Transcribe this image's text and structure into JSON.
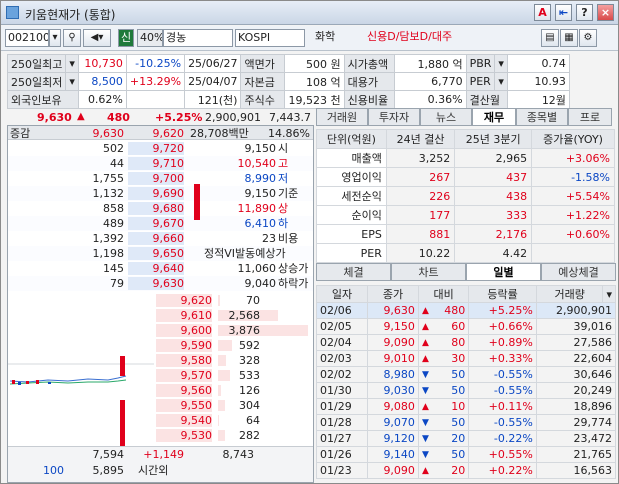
{
  "window": {
    "title": "키움현재가 (통합)",
    "buttons": [
      "A",
      "⇤",
      "?",
      "×"
    ]
  },
  "toolbar": {
    "code": "002100",
    "badge_sin": "신",
    "ratio": "40%",
    "name": "경농",
    "market": "KOSPI",
    "sector": "화학",
    "credit": "신용D/담보D/대주"
  },
  "info": {
    "rows": [
      [
        "250일최고",
        "10,730",
        "-10.25%",
        "25/06/27",
        "액면가",
        "500 원",
        "시가총액",
        "1,880 억",
        "PBR",
        "0.74"
      ],
      [
        "250일최저",
        "8,500",
        "+13.29%",
        "25/04/07",
        "자본금",
        "108 억",
        "대용가",
        "6,770",
        "PER",
        "10.93"
      ],
      [
        "외국인보유",
        "0.62%",
        "",
        "121(천)",
        "주식수",
        "19,523 천",
        "신용비율",
        "0.36%",
        "결산월",
        "12월"
      ]
    ]
  },
  "price": {
    "current": "9,630",
    "change": "480",
    "rate": "+5.25%",
    "volume": "2,900,901",
    "extra": "7,443.7"
  },
  "hoga": {
    "header": [
      "증감",
      "9,630",
      "9,620",
      "28,708백만",
      "14.86%"
    ],
    "ask": [
      {
        "qty": "502",
        "price": "9,720",
        "label_v": "9,150",
        "label_k": "시"
      },
      {
        "qty": "44",
        "price": "9,710",
        "label_v": "10,540",
        "label_k": "고"
      },
      {
        "qty": "1,755",
        "price": "9,700",
        "label_v": "8,990",
        "label_k": "저"
      },
      {
        "qty": "1,132",
        "price": "9,690",
        "label_v": "9,150",
        "label_k": "기준"
      },
      {
        "qty": "858",
        "price": "9,680",
        "label_v": "11,890",
        "label_k": "상"
      },
      {
        "qty": "489",
        "price": "9,670",
        "label_v": "6,410",
        "label_k": "하"
      },
      {
        "qty": "1,392",
        "price": "9,660",
        "label_v": "23",
        "label_k": "비용"
      },
      {
        "qty": "1,198",
        "price": "9,650",
        "label_v": "정적VI발동예상가",
        "label_k": ""
      },
      {
        "qty": "145",
        "price": "9,640",
        "label_v": "11,060",
        "label_k": "상승가"
      },
      {
        "qty": "79",
        "price": "9,630",
        "label_v": "9,040",
        "label_k": "하락가"
      }
    ],
    "bid": [
      {
        "price": "9,620",
        "qty": "70"
      },
      {
        "price": "9,610",
        "qty": "2,568"
      },
      {
        "price": "9,600",
        "qty": "3,876"
      },
      {
        "price": "9,590",
        "qty": "592"
      },
      {
        "price": "9,580",
        "qty": "328"
      },
      {
        "price": "9,570",
        "qty": "533"
      },
      {
        "price": "9,560",
        "qty": "126"
      },
      {
        "price": "9,550",
        "qty": "304"
      },
      {
        "price": "9,540",
        "qty": "64"
      },
      {
        "price": "9,530",
        "qty": "282"
      }
    ],
    "footer": {
      "ask_total": "7,594",
      "diff": "+1,149",
      "bid_total": "8,743",
      "left": "100",
      "ask_total2": "5,895",
      "time": "시간외"
    }
  },
  "tabs_top": [
    "거래원",
    "투자자",
    "뉴스",
    "재무",
    "종목별",
    "프로"
  ],
  "fin": {
    "header": [
      "단위(억원)",
      "24년 결산",
      "25년 3분기",
      "증가율(YOY)"
    ],
    "rows": [
      [
        "매출액",
        "3,252",
        "2,965",
        "+3.06%"
      ],
      [
        "영업이익",
        "267",
        "437",
        "-1.58%"
      ],
      [
        "세전순익",
        "226",
        "438",
        "+5.54%"
      ],
      [
        "순이익",
        "177",
        "333",
        "+1.22%"
      ],
      [
        "EPS",
        "881",
        "2,176",
        "+0.60%"
      ],
      [
        "PER",
        "10.22",
        "4.42",
        ""
      ]
    ]
  },
  "tabs_bottom": [
    "체결",
    "차트",
    "일별",
    "예상체결"
  ],
  "daily": {
    "header": [
      "일자",
      "종가",
      "대비",
      "등락률",
      "거래량"
    ],
    "rows": [
      [
        "02/06",
        "9,630",
        "▲",
        "480",
        "+5.25%",
        "2,900,901"
      ],
      [
        "02/05",
        "9,150",
        "▲",
        "60",
        "+0.66%",
        "39,016"
      ],
      [
        "02/04",
        "9,090",
        "▲",
        "80",
        "+0.89%",
        "27,586"
      ],
      [
        "02/03",
        "9,010",
        "▲",
        "30",
        "+0.33%",
        "22,604"
      ],
      [
        "02/02",
        "8,980",
        "▼",
        "50",
        "-0.55%",
        "30,646"
      ],
      [
        "01/30",
        "9,030",
        "▼",
        "50",
        "-0.55%",
        "20,249"
      ],
      [
        "01/29",
        "9,080",
        "▲",
        "10",
        "+0.11%",
        "18,896"
      ],
      [
        "01/28",
        "9,070",
        "▼",
        "50",
        "-0.55%",
        "29,774"
      ],
      [
        "01/27",
        "9,120",
        "▼",
        "20",
        "-0.22%",
        "23,472"
      ],
      [
        "01/26",
        "9,140",
        "▼",
        "50",
        "+0.55%",
        "21,765"
      ],
      [
        "01/23",
        "9,090",
        "▲",
        "20",
        "+0.22%",
        "16,563"
      ]
    ]
  }
}
